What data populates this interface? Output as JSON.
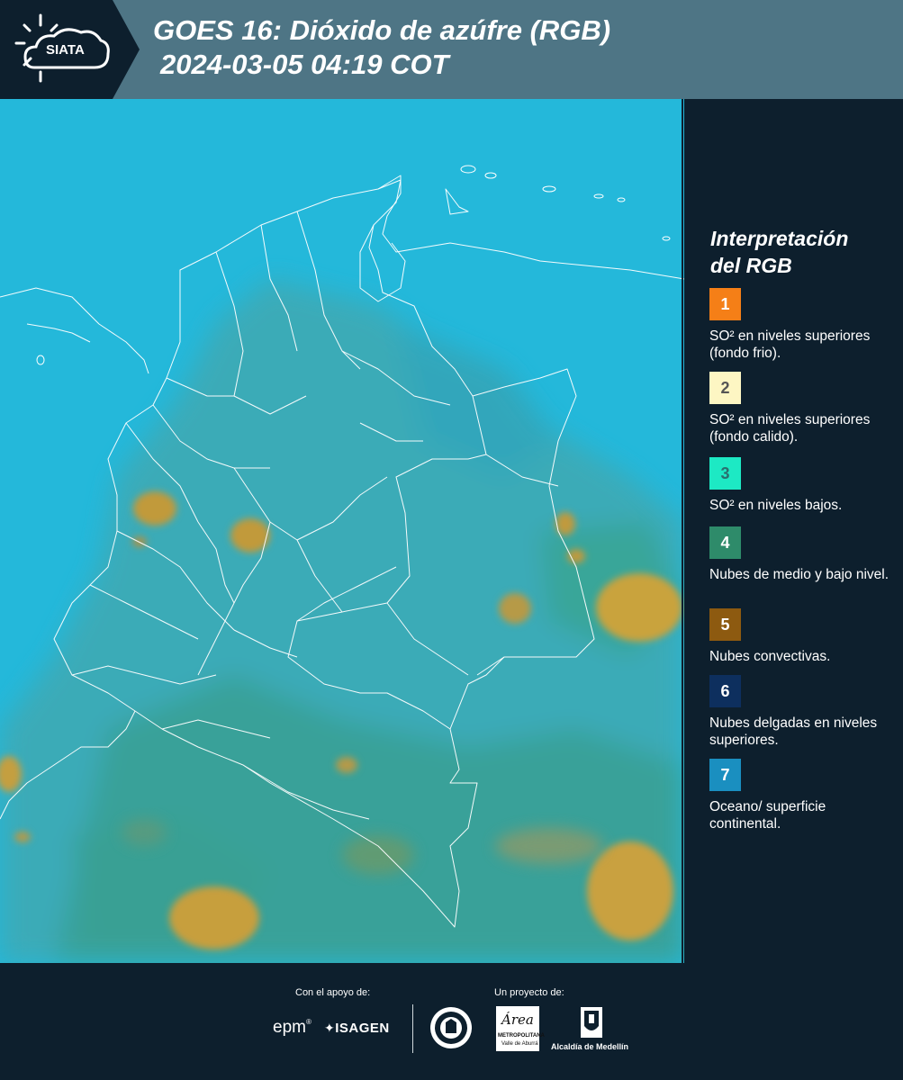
{
  "header": {
    "logo_text": "SIATA",
    "title_line1": "GOES 16: Dióxido de azúfre (RGB)",
    "title_line2": "2024-03-05 04:19 COT",
    "background_color": "#4e7585",
    "logo_background_color": "#0d1f2d"
  },
  "map": {
    "description_icon": "satellite-map",
    "ocean_color": "#22b6d8",
    "land_color": "#3aa8b8",
    "cloud_color": "#c8a040"
  },
  "legend": {
    "title_line1": "Interpretación",
    "title_line2": "del RGB",
    "items": [
      {
        "number": "1",
        "color": "#f57f17",
        "text_color": "#ffffff",
        "label": "SO² en niveles superiores (fondo frio)."
      },
      {
        "number": "2",
        "color": "#fdf6c3",
        "text_color": "#555555",
        "label": "SO² en niveles superiores (fondo calido)."
      },
      {
        "number": "3",
        "color": "#1de9c4",
        "text_color": "#2a6f6f",
        "label": "SO² en niveles bajos."
      },
      {
        "number": "4",
        "color": "#2e8b6a",
        "text_color": "#ffffff",
        "label": "Nubes de medio y bajo nivel."
      },
      {
        "number": "5",
        "color": "#8d5a10",
        "text_color": "#ffffff",
        "label": "Nubes convectivas."
      },
      {
        "number": "6",
        "color": "#0d2f5e",
        "text_color": "#ffffff",
        "label": "Nubes delgadas en niveles superiores."
      },
      {
        "number": "7",
        "color": "#1a8fc0",
        "text_color": "#ffffff",
        "label": "Oceano/ superficie continental."
      }
    ]
  },
  "footer": {
    "support_label": "Con el apoyo de:",
    "project_label": "Un proyecto de:",
    "sponsor1": "epm",
    "sponsor2": "ISAGEN",
    "partner_area_top": "Área",
    "partner_area_sub": "METROPOLITANA",
    "partner_area_sub2": "Valle de Aburrá",
    "partner_alcaldia": "Alcaldía de Medellín"
  }
}
